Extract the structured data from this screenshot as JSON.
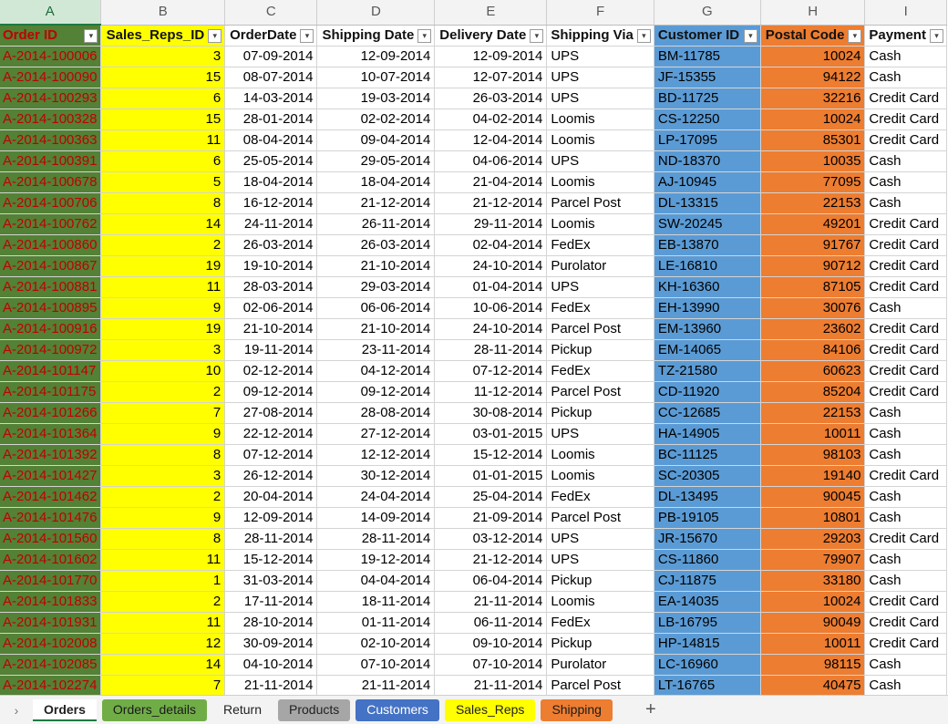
{
  "columns": [
    "A",
    "B",
    "C",
    "D",
    "E",
    "F",
    "G",
    "H",
    "I"
  ],
  "headers": [
    "Order ID",
    "Sales_Reps_ID",
    "OrderDate",
    "Shipping Date",
    "Delivery Date",
    "Shipping Via",
    "Customer ID",
    "Postal Code",
    "Payment"
  ],
  "rows": [
    [
      "A-2014-100006",
      "3",
      "07-09-2014",
      "12-09-2014",
      "12-09-2014",
      "UPS",
      "BM-11785",
      "10024",
      "Cash"
    ],
    [
      "A-2014-100090",
      "15",
      "08-07-2014",
      "10-07-2014",
      "12-07-2014",
      "UPS",
      "JF-15355",
      "94122",
      "Cash"
    ],
    [
      "A-2014-100293",
      "6",
      "14-03-2014",
      "19-03-2014",
      "26-03-2014",
      "UPS",
      "BD-11725",
      "32216",
      "Credit Card"
    ],
    [
      "A-2014-100328",
      "15",
      "28-01-2014",
      "02-02-2014",
      "04-02-2014",
      "Loomis",
      "CS-12250",
      "10024",
      "Credit Card"
    ],
    [
      "A-2014-100363",
      "11",
      "08-04-2014",
      "09-04-2014",
      "12-04-2014",
      "Loomis",
      "LP-17095",
      "85301",
      "Credit Card"
    ],
    [
      "A-2014-100391",
      "6",
      "25-05-2014",
      "29-05-2014",
      "04-06-2014",
      "UPS",
      "ND-18370",
      "10035",
      "Cash"
    ],
    [
      "A-2014-100678",
      "5",
      "18-04-2014",
      "18-04-2014",
      "21-04-2014",
      "Loomis",
      "AJ-10945",
      "77095",
      "Cash"
    ],
    [
      "A-2014-100706",
      "8",
      "16-12-2014",
      "21-12-2014",
      "21-12-2014",
      "Parcel Post",
      "DL-13315",
      "22153",
      "Cash"
    ],
    [
      "A-2014-100762",
      "14",
      "24-11-2014",
      "26-11-2014",
      "29-11-2014",
      "Loomis",
      "SW-20245",
      "49201",
      "Credit Card"
    ],
    [
      "A-2014-100860",
      "2",
      "26-03-2014",
      "26-03-2014",
      "02-04-2014",
      "FedEx",
      "EB-13870",
      "91767",
      "Credit Card"
    ],
    [
      "A-2014-100867",
      "19",
      "19-10-2014",
      "21-10-2014",
      "24-10-2014",
      "Purolator",
      "LE-16810",
      "90712",
      "Credit Card"
    ],
    [
      "A-2014-100881",
      "11",
      "28-03-2014",
      "29-03-2014",
      "01-04-2014",
      "UPS",
      "KH-16360",
      "87105",
      "Credit Card"
    ],
    [
      "A-2014-100895",
      "9",
      "02-06-2014",
      "06-06-2014",
      "10-06-2014",
      "FedEx",
      "EH-13990",
      "30076",
      "Cash"
    ],
    [
      "A-2014-100916",
      "19",
      "21-10-2014",
      "21-10-2014",
      "24-10-2014",
      "Parcel Post",
      "EM-13960",
      "23602",
      "Credit Card"
    ],
    [
      "A-2014-100972",
      "3",
      "19-11-2014",
      "23-11-2014",
      "28-11-2014",
      "Pickup",
      "EM-14065",
      "84106",
      "Credit Card"
    ],
    [
      "A-2014-101147",
      "10",
      "02-12-2014",
      "04-12-2014",
      "07-12-2014",
      "FedEx",
      "TZ-21580",
      "60623",
      "Credit Card"
    ],
    [
      "A-2014-101175",
      "2",
      "09-12-2014",
      "09-12-2014",
      "11-12-2014",
      "Parcel Post",
      "CD-11920",
      "85204",
      "Credit Card"
    ],
    [
      "A-2014-101266",
      "7",
      "27-08-2014",
      "28-08-2014",
      "30-08-2014",
      "Pickup",
      "CC-12685",
      "22153",
      "Cash"
    ],
    [
      "A-2014-101364",
      "9",
      "22-12-2014",
      "27-12-2014",
      "03-01-2015",
      "UPS",
      "HA-14905",
      "10011",
      "Cash"
    ],
    [
      "A-2014-101392",
      "8",
      "07-12-2014",
      "12-12-2014",
      "15-12-2014",
      "Loomis",
      "BC-11125",
      "98103",
      "Cash"
    ],
    [
      "A-2014-101427",
      "3",
      "26-12-2014",
      "30-12-2014",
      "01-01-2015",
      "Loomis",
      "SC-20305",
      "19140",
      "Credit Card"
    ],
    [
      "A-2014-101462",
      "2",
      "20-04-2014",
      "24-04-2014",
      "25-04-2014",
      "FedEx",
      "DL-13495",
      "90045",
      "Cash"
    ],
    [
      "A-2014-101476",
      "9",
      "12-09-2014",
      "14-09-2014",
      "21-09-2014",
      "Parcel Post",
      "PB-19105",
      "10801",
      "Cash"
    ],
    [
      "A-2014-101560",
      "8",
      "28-11-2014",
      "28-11-2014",
      "03-12-2014",
      "UPS",
      "JR-15670",
      "29203",
      "Credit Card"
    ],
    [
      "A-2014-101602",
      "11",
      "15-12-2014",
      "19-12-2014",
      "21-12-2014",
      "UPS",
      "CS-11860",
      "79907",
      "Cash"
    ],
    [
      "A-2014-101770",
      "1",
      "31-03-2014",
      "04-04-2014",
      "06-04-2014",
      "Pickup",
      "CJ-11875",
      "33180",
      "Cash"
    ],
    [
      "A-2014-101833",
      "2",
      "17-11-2014",
      "18-11-2014",
      "21-11-2014",
      "Loomis",
      "EA-14035",
      "10024",
      "Credit Card"
    ],
    [
      "A-2014-101931",
      "11",
      "28-10-2014",
      "01-11-2014",
      "06-11-2014",
      "FedEx",
      "LB-16795",
      "90049",
      "Credit Card"
    ],
    [
      "A-2014-102008",
      "12",
      "30-09-2014",
      "02-10-2014",
      "09-10-2014",
      "Pickup",
      "HP-14815",
      "10011",
      "Credit Card"
    ],
    [
      "A-2014-102085",
      "14",
      "04-10-2014",
      "07-10-2014",
      "07-10-2014",
      "Purolator",
      "LC-16960",
      "98115",
      "Cash"
    ],
    [
      "A-2014-102274",
      "7",
      "21-11-2014",
      "21-11-2014",
      "21-11-2014",
      "Parcel Post",
      "LT-16765",
      "40475",
      "Cash"
    ]
  ],
  "tabs": [
    "Orders",
    "Orders_details",
    "Return",
    "Products",
    "Customers",
    "Sales_Reps",
    "Shipping"
  ],
  "active_tab": "Orders",
  "icons": {
    "nav": "chevron-right-icon",
    "add": "plus-icon",
    "filter": "filter-dropdown-icon"
  },
  "colors": {
    "col_a": "#538135",
    "col_b": "#ffff00",
    "col_g": "#5b9bd5",
    "col_h": "#ed7d31",
    "order_id_text": "#c00000",
    "tab_orders_details": "#70ad47",
    "tab_products": "#a6a6a6",
    "tab_customers": "#4472c4",
    "tab_sales_reps": "#ffff00",
    "tab_shipping": "#ed7d31"
  }
}
